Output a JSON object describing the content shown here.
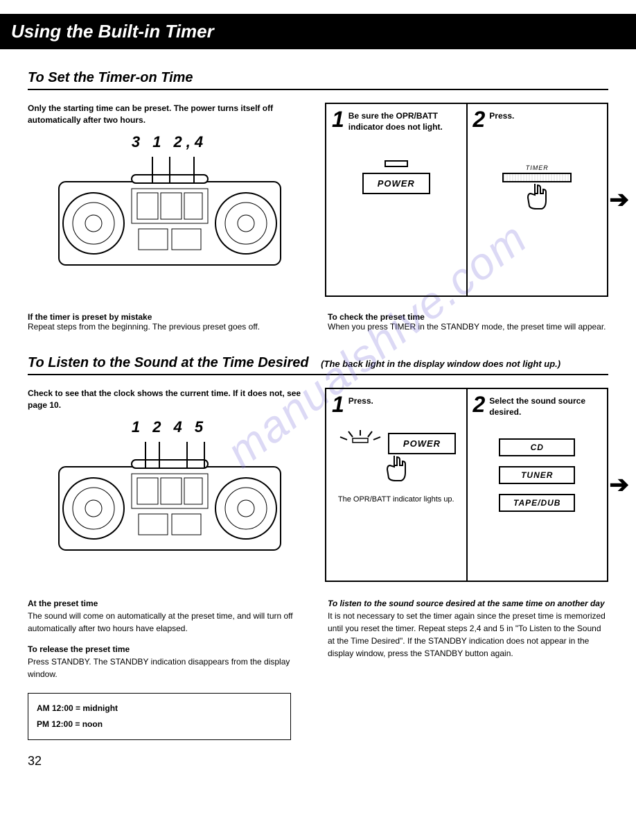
{
  "titleBar": "Using the Built-in Timer",
  "section1": {
    "heading": "To Set the Timer-on Time",
    "intro": "Only the starting time can be preset. The power turns itself off automatically after two hours.",
    "deviceNums": "3  1   2,4",
    "step1": {
      "num": "1",
      "text": "Be sure the OPR/BATT indicator does not light."
    },
    "step2": {
      "num": "2",
      "text": "Press."
    },
    "powerLabel": "POWER",
    "timerLabel": "TIMER",
    "leftNote": {
      "h": "If the timer is preset by mistake",
      "t": "Repeat steps from the beginning. The previous preset goes off."
    },
    "rightNote": {
      "h": "To check the preset time",
      "t": "When you press TIMER in the STANDBY mode, the preset time will appear."
    }
  },
  "section2": {
    "heading": "To Listen to the Sound at the Time Desired",
    "headingNote": "(The back light in the display window does not light up.)",
    "intro": "Check to see that the clock shows the current time. If it does not, see page 10.",
    "deviceNums": "1 2    4   5",
    "step1": {
      "num": "1",
      "text": "Press."
    },
    "step2": {
      "num": "2",
      "text": "Select the sound source desired."
    },
    "powerLabel": "POWER",
    "indicatorText": "The OPR/BATT indicator lights up.",
    "buttons": {
      "cd": "CD",
      "tuner": "TUNER",
      "tape": "TAPE/DUB"
    },
    "foot": {
      "l1h": "At the preset time",
      "l1t": "The sound will come on automatically at the preset time, and will turn off automatically after two hours have elapsed.",
      "l2h": "To release the preset time",
      "l2t": "Press STANDBY. The STANDBY indication disappears from the display window.",
      "r1h": "To listen to the sound source desired at the same time on another day",
      "r1t": "It is not necessary to set the timer again since the preset time is memorized until you reset the timer. Repeat steps 2,4 and 5 in \"To Listen to the Sound at the Time Desired\". If the STANDBY indication does not appear in the display window, press the STANDBY button again."
    }
  },
  "timeTable": {
    "am": "AM 12:00  =  midnight",
    "pm": "PM 12:00  =  noon"
  },
  "pageNum": "32",
  "watermark": "manualshive.com"
}
